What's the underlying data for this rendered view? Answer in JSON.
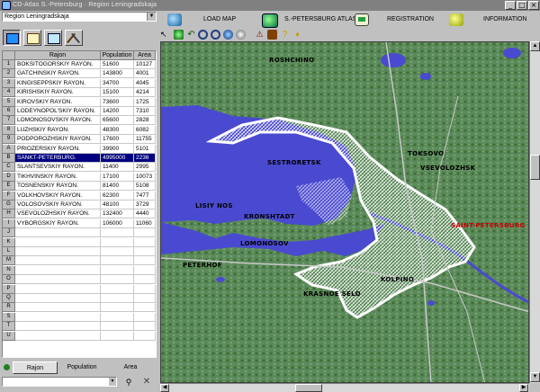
{
  "window": {
    "title": "CD-Atlas S.-Petersburg · Region Leningradskaja"
  },
  "region_select": {
    "value": "Region Leningradskaja"
  },
  "toolbar": {
    "load_map": "LOAD MAP",
    "spb_atlas": "S.-PETERSBURG ATLAS",
    "registration": "REGISTRATION",
    "information": "INFORMATION"
  },
  "table": {
    "headers": [
      "Rajon",
      "Population",
      "Area"
    ],
    "row_letters": [
      "1",
      "2",
      "3",
      "4",
      "5",
      "6",
      "7",
      "8",
      "9",
      "A",
      "B",
      "C",
      "D",
      "E",
      "F",
      "G",
      "H",
      "I",
      "J",
      "K",
      "L",
      "M",
      "N",
      "O",
      "P",
      "Q",
      "R",
      "S",
      "T",
      "U"
    ],
    "rows": [
      {
        "name": "BOKSITOGORSKIY RAYON.",
        "population": "51600",
        "area": "10127"
      },
      {
        "name": "GATCHINSKIY RAYON.",
        "population": "143800",
        "area": "4001"
      },
      {
        "name": "KINGISEPPSKIY RAYON.",
        "population": "34700",
        "area": "4045"
      },
      {
        "name": "KIRISHSKIY RAYON.",
        "population": "15100",
        "area": "4214"
      },
      {
        "name": "KIROVSKIY RAYON.",
        "population": "73600",
        "area": "1725"
      },
      {
        "name": "LODEYNOPOL'SKIY RAYON.",
        "population": "14200",
        "area": "7310"
      },
      {
        "name": "LOMONOSOVSKIY RAYON.",
        "population": "65600",
        "area": "2828"
      },
      {
        "name": "LUZHSKIY RAYON.",
        "population": "48300",
        "area": "6082"
      },
      {
        "name": "PODPOROZHSKIY RAYON.",
        "population": "17600",
        "area": "11755"
      },
      {
        "name": "PRIOZERSKIY RAYON.",
        "population": "39900",
        "area": "5101"
      },
      {
        "name": "SANKT-PETERBURG.",
        "population": "4995000",
        "area": "2236"
      },
      {
        "name": "SLANTSEVSKIY RAYON.",
        "population": "11400",
        "area": "2995"
      },
      {
        "name": "TIKHVINSKIY RAYON.",
        "population": "17100",
        "area": "10073"
      },
      {
        "name": "TOSNENSKIY RAYON.",
        "population": "81400",
        "area": "5108"
      },
      {
        "name": "VOLKHOVSKIY RAYON.",
        "population": "62300",
        "area": "7477"
      },
      {
        "name": "VOLOSOVSKIY RAYON.",
        "population": "48100",
        "area": "3729"
      },
      {
        "name": "VSEVOLOZHSKIY RAYON.",
        "population": "132400",
        "area": "4440"
      },
      {
        "name": "VYBORGSKIY RAYON.",
        "population": "106000",
        "area": "11060"
      }
    ],
    "selected_index": 10
  },
  "bottom_tabs": [
    "Rajon",
    "Population",
    "Area"
  ],
  "map": {
    "labels": [
      "SESTRORETSK",
      "KRONSHTADT",
      "SAINT-PETERSBURG",
      "VSEVOLOZHSK",
      "TOKSOVO",
      "LOMONOSOV",
      "KRASNOE SELO",
      "ROSHCHINO",
      "KOLPINO",
      "PETERHOF",
      "LISIY NOS"
    ],
    "highlight_label": "SAINT-PETERSBURG"
  },
  "colors": {
    "selection": "#000080",
    "water": "#4a4ad0",
    "land": "#5a8a5a",
    "highlight": "#cc0000"
  },
  "icons": {
    "load_map": "globe-arrow-icon",
    "spb_atlas": "atlas-globe-icon",
    "registration": "registration-icon",
    "information": "information-icon"
  }
}
